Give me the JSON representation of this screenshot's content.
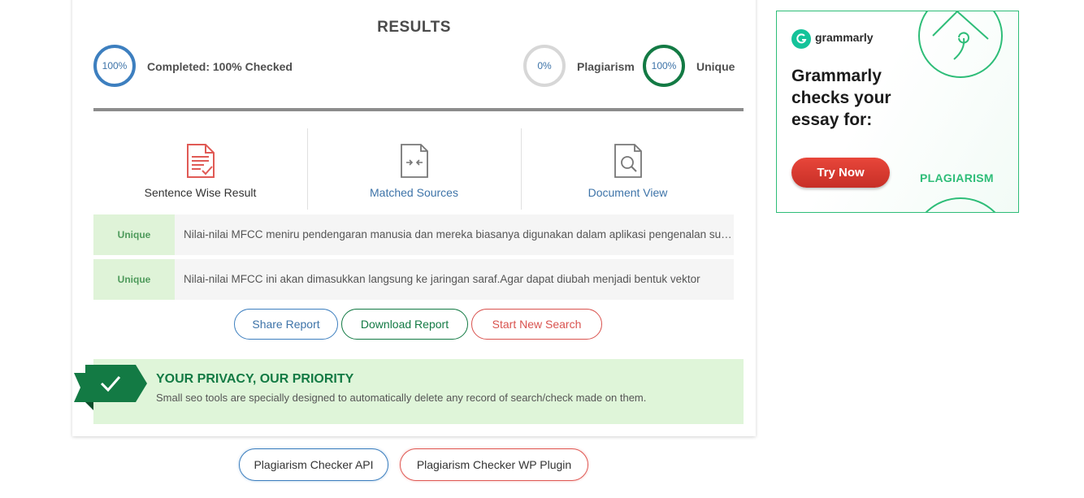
{
  "results": {
    "title": "RESULTS",
    "completed": {
      "ring": "100%",
      "label": "Completed: 100% Checked",
      "progress_percent": 100
    },
    "plagiarism": {
      "ring": "0%",
      "label": "Plagiarism"
    },
    "unique": {
      "ring": "100%",
      "label": "Unique"
    }
  },
  "tabs": [
    {
      "label": "Sentence Wise Result",
      "icon": "document-check-icon",
      "color": "#333333"
    },
    {
      "label": "Matched Sources",
      "icon": "compare-document-icon",
      "color": "#3d73a8"
    },
    {
      "label": "Document View",
      "icon": "document-search-icon",
      "color": "#3d73a8"
    }
  ],
  "sentences": [
    {
      "status": "Unique",
      "text": "Nilai-nilai MFCC meniru pendengaran manusia dan mereka biasanya digunakan dalam aplikasi pengenalan suara"
    },
    {
      "status": "Unique",
      "text": "Nilai-nilai MFCC ini akan dimasukkan langsung ke jaringan saraf.Agar dapat diubah menjadi bentuk vektor"
    }
  ],
  "actions": {
    "share": "Share Report",
    "download": "Download Report",
    "new_search": "Start New Search"
  },
  "privacy": {
    "title": "YOUR PRIVACY, OUR PRIORITY",
    "text": "Small seo tools are specially designed to automatically delete any record of search/check made on them."
  },
  "bottom_links": {
    "api": "Plagiarism Checker API",
    "wp_plugin": "Plagiarism Checker WP Plugin"
  },
  "ad": {
    "brand": "grammarly",
    "headline": "Grammarly checks your essay for:",
    "cta": "Try Now",
    "tag": "PLAGIARISM",
    "accent": "#2ebd78"
  },
  "colors": {
    "blue": "#3d7fbf",
    "green": "#137a44",
    "red": "#d9534f",
    "badge_bg": "#dff3d8"
  }
}
